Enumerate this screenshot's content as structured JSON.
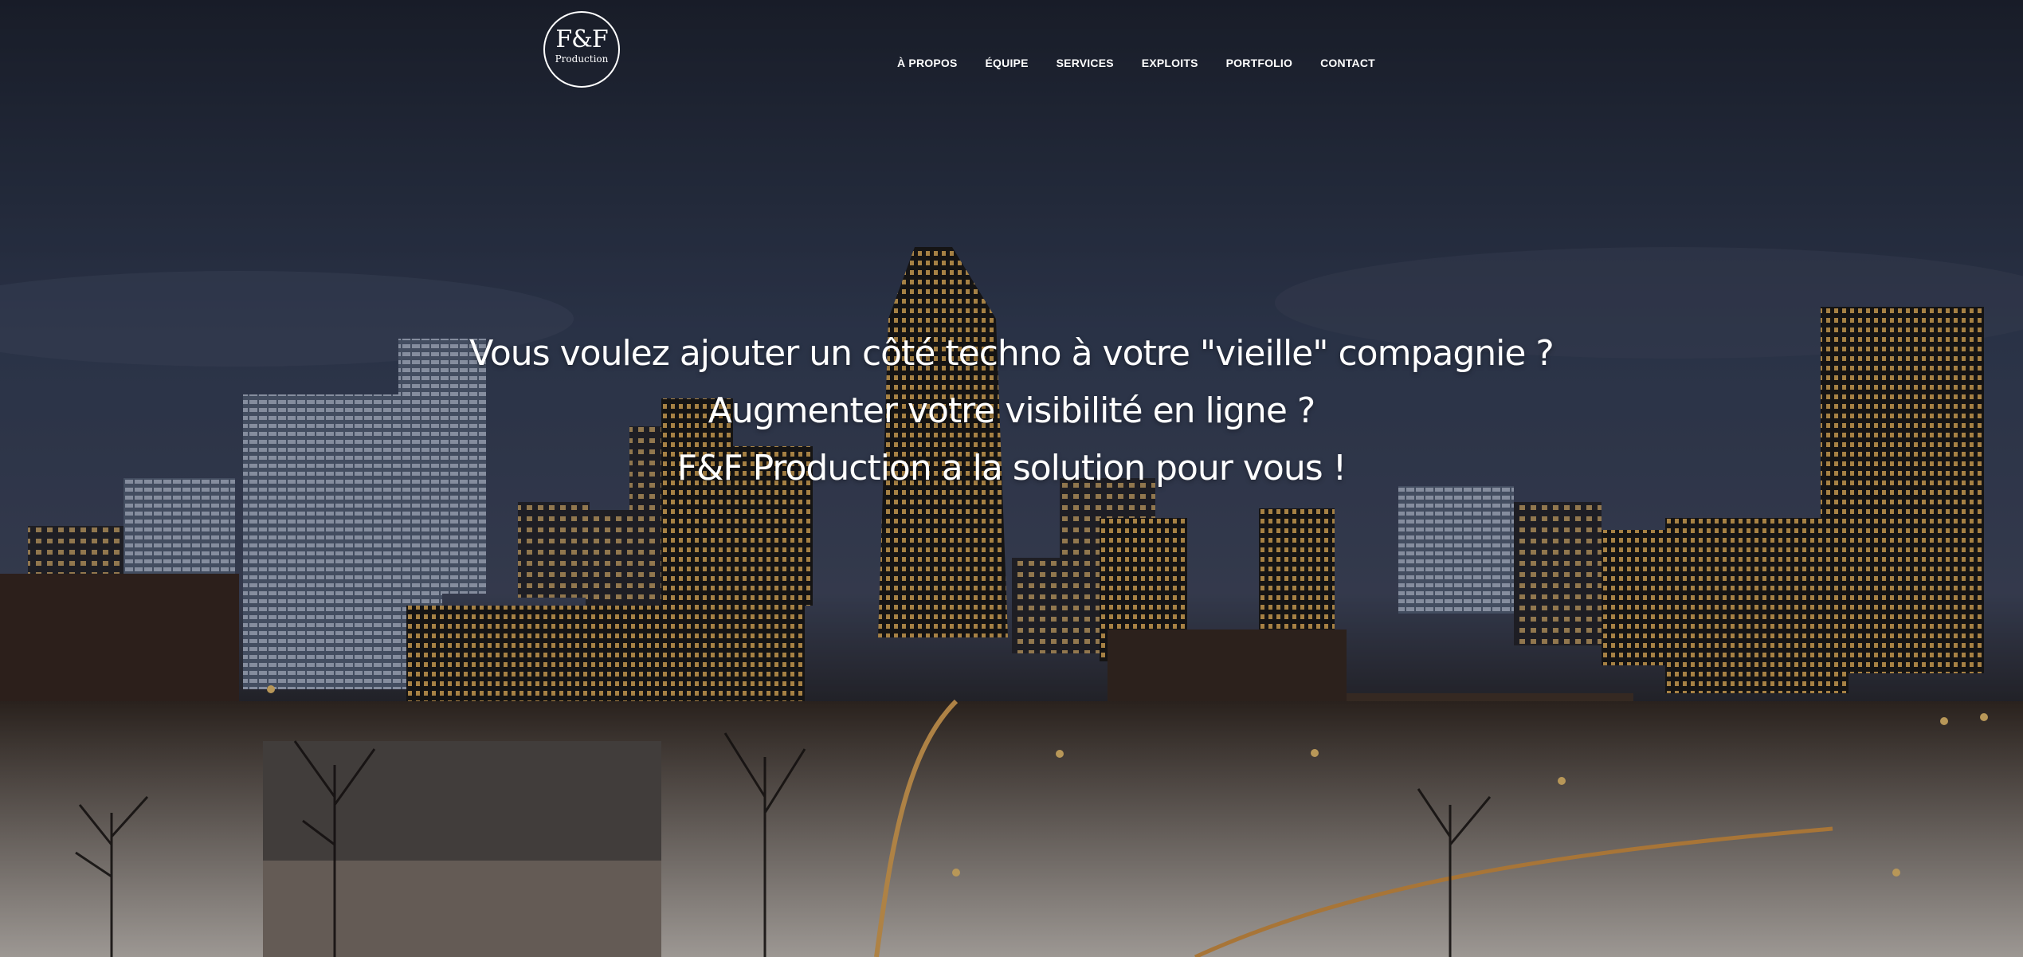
{
  "brand": {
    "logo_mark": "F&F",
    "logo_sub": "Production"
  },
  "nav": {
    "items": [
      {
        "label": "À PROPOS"
      },
      {
        "label": "ÉQUIPE"
      },
      {
        "label": "SERVICES"
      },
      {
        "label": "EXPLOITS"
      },
      {
        "label": "PORTFOLIO"
      },
      {
        "label": "CONTACT"
      }
    ]
  },
  "hero": {
    "line1": "Vous voulez ajouter un côté techno à votre \"vieille\" compagnie ?",
    "line2": "Augmenter votre visibilité en ligne ?",
    "line3": "F&F Production a la solution pour vous !",
    "background_image": "night-city-skyline"
  },
  "colors": {
    "text": "#ffffff",
    "sky": "#2f3850"
  }
}
